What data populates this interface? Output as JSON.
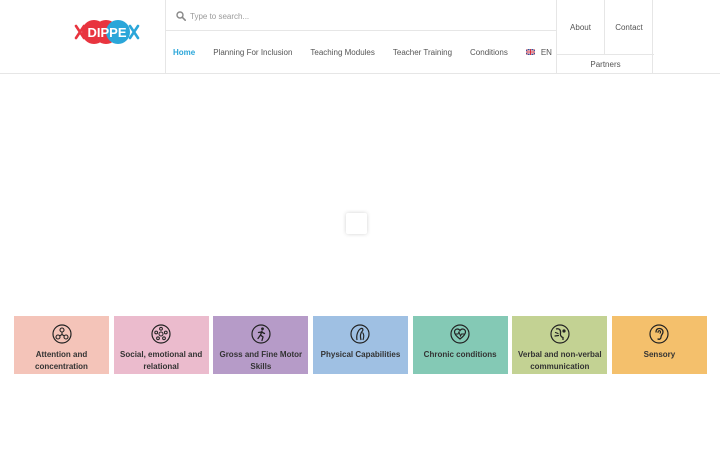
{
  "logo": {
    "text": "DIPPEx"
  },
  "search": {
    "placeholder": "Type to search..."
  },
  "nav": {
    "items": [
      {
        "label": "Home"
      },
      {
        "label": "Planning For Inclusion"
      },
      {
        "label": "Teaching Modules"
      },
      {
        "label": "Teacher Training"
      },
      {
        "label": "Conditions"
      }
    ],
    "language": "EN"
  },
  "utility": {
    "about": "About",
    "contact": "Contact",
    "partners": "Partners"
  },
  "tiles": [
    {
      "label": "Attention and concentration",
      "color": "#f4c4b9",
      "icon": "attention-icon"
    },
    {
      "label": "Social, emotional and relational",
      "color": "#ebbbcd",
      "icon": "social-icon"
    },
    {
      "label": "Gross and Fine Motor Skills",
      "color": "#b69bc8",
      "icon": "motor-icon"
    },
    {
      "label": "Physical Capabilities",
      "color": "#9fc0e3",
      "icon": "physical-icon"
    },
    {
      "label": "Chronic conditions",
      "color": "#84c9b5",
      "icon": "heart-icon"
    },
    {
      "label": "Verbal and non-verbal communication",
      "color": "#c3d293",
      "icon": "communication-icon"
    },
    {
      "label": "Sensory",
      "color": "#f4c06c",
      "icon": "ear-icon"
    }
  ],
  "colors": {
    "accent": "#2aa6d9",
    "logo_red": "#e8343f",
    "logo_blue": "#2aa6d9"
  }
}
